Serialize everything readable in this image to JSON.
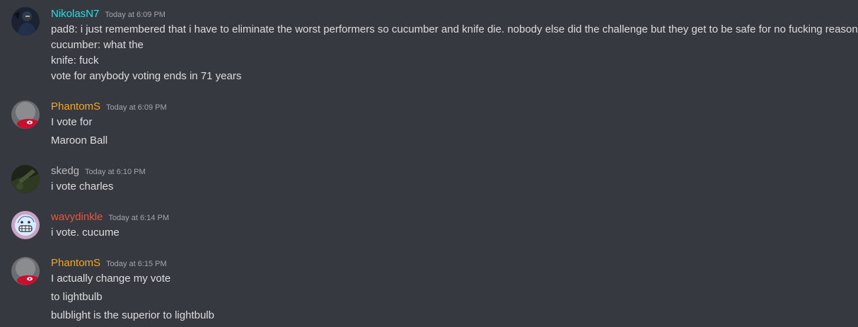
{
  "messages": [
    {
      "username": "NikolasN7",
      "username_color": "#1fe0e8",
      "timestamp": "Today at 6:09 PM",
      "lines": [
        "pad8: i just remembered that i have to eliminate the worst performers so cucumber and knife die. nobody else did the challenge but they get to be safe for no fucking reason",
        "cucumber: what the",
        "knife: fuck",
        "vote for anybody voting ends in 71 years"
      ]
    },
    {
      "username": "PhantomS",
      "username_color": "#f5a623",
      "timestamp": "Today at 6:09 PM",
      "lines": [
        "I vote for",
        "Maroon Ball"
      ]
    },
    {
      "username": "skedg",
      "username_color": "#b9bbbe",
      "timestamp": "Today at 6:10 PM",
      "lines": [
        "i vote charles"
      ]
    },
    {
      "username": "wavydinkle",
      "username_color": "#e8573b",
      "timestamp": "Today at 6:14 PM",
      "lines": [
        "i vote. cucume"
      ]
    },
    {
      "username": "PhantomS",
      "username_color": "#f5a623",
      "timestamp": "Today at 6:15 PM",
      "lines": [
        "I actually change my vote",
        "to lightbulb",
        "bulblight is the superior to lightbulb"
      ]
    }
  ],
  "avatars": {
    "nikolas": "dark-figure-avatar",
    "phantom": "red-cap-avatar",
    "skedg": "dark-green-avatar",
    "wavydinkle": "grinning-face-avatar"
  }
}
